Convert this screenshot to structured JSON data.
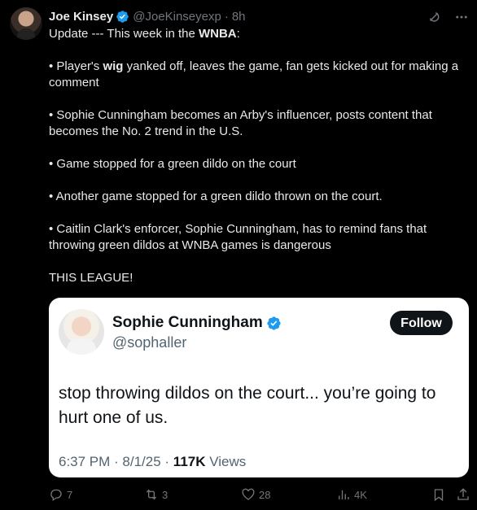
{
  "author": {
    "name": "Joe Kinsey",
    "handle": "@JoeKinseyexp",
    "separator": "·",
    "time": "8h"
  },
  "tweet": {
    "p1_a": "Update --- This week in the ",
    "p1_b": "WNBA",
    "p1_c": ":",
    "p2_a": "• Player's ",
    "p2_b": "wig",
    "p2_c": " yanked off, leaves the game, fan gets kicked out for making a comment",
    "p3": "• Sophie Cunningham becomes an Arby's influencer, posts content that becomes the No. 2 trend in the U.S.",
    "p4": "• Game stopped for a green dildo on the court",
    "p5": "• Another game stopped for a green dildo thrown on the court.",
    "p6": "• Caitlin Clark's enforcer, Sophie Cunningham, has to remind fans that throwing green dildos at WNBA games is dangerous",
    "p7": "THIS LEAGUE!"
  },
  "quoted": {
    "name": "Sophie Cunningham",
    "handle": "@sophaller",
    "follow_label": "Follow",
    "text": "stop throwing dildos on the court... you’re going to hurt one of us.",
    "time": "6:37 PM",
    "date": "8/1/25",
    "views_count": "117K",
    "views_label": " Views",
    "sep": " · "
  },
  "actions": {
    "replies": "7",
    "retweets": "3",
    "likes": "28",
    "views": "4K"
  },
  "colors": {
    "verified": "#1d9bf0",
    "background": "#000000",
    "muted": "#71767b"
  },
  "icons": [
    "verified-icon",
    "grok-icon",
    "more-icon",
    "reply-icon",
    "retweet-icon",
    "like-icon",
    "views-icon",
    "bookmark-icon",
    "share-icon"
  ]
}
